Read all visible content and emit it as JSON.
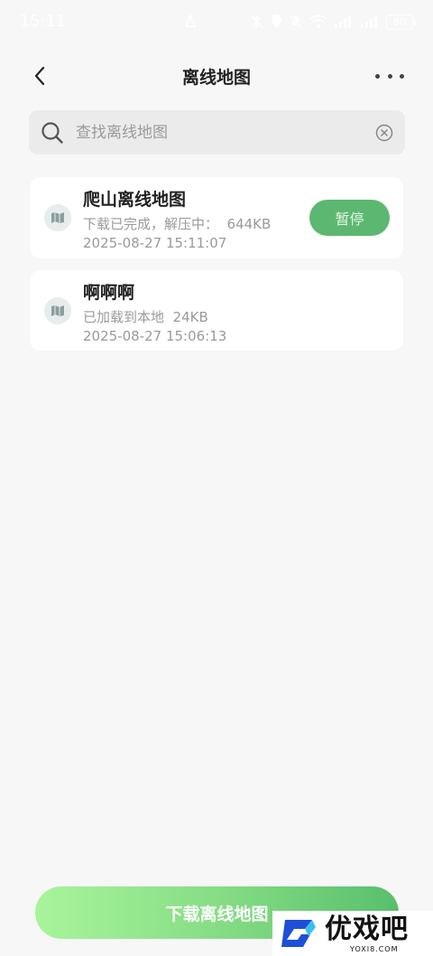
{
  "status_bar": {
    "time": "15:11",
    "battery": "80"
  },
  "header": {
    "title": "离线地图"
  },
  "search": {
    "placeholder": "查找离线地图",
    "value": ""
  },
  "maps": [
    {
      "name": "爬山离线地图",
      "status": "下载已完成，解压中：  644KB",
      "time": "2025-08-27 15:11:07",
      "action": "暂停"
    },
    {
      "name": "啊啊啊",
      "status": "已加载到本地  24KB",
      "time": "2025-08-27 15:06:13"
    }
  ],
  "footer": {
    "download_label": "下载离线地图"
  },
  "watermark": {
    "main": "优戏吧",
    "sub": "YOXI8.COM"
  },
  "colors": {
    "accent_green": "#5cb870",
    "background": "#f7f7f7"
  }
}
